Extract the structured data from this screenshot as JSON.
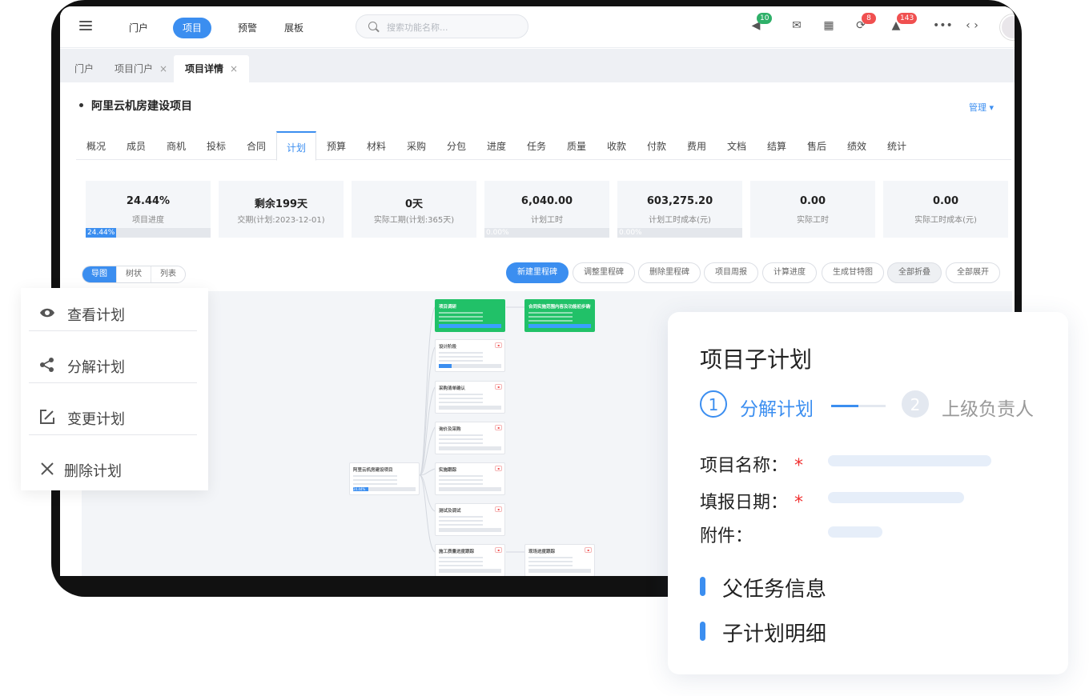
{
  "topnav": {
    "items": [
      "门户",
      "项目",
      "预警",
      "展板"
    ],
    "active_index": 1,
    "search_placeholder": "搜索功能名称...",
    "badges": {
      "announce": "10",
      "sync": "8",
      "bell": "143"
    },
    "icons": [
      "megaphone-icon",
      "mail-icon",
      "calendar-icon",
      "sync-icon",
      "bell-icon",
      "more-icon",
      "code-icon"
    ]
  },
  "page_tabs": [
    {
      "label": "门户",
      "closable": false
    },
    {
      "label": "项目门户",
      "closable": true
    },
    {
      "label": "项目详情",
      "closable": true,
      "active": true
    }
  ],
  "project": {
    "title": "阿里云机房建设项目",
    "manage_label": "管理",
    "subtabs": [
      "概况",
      "成员",
      "商机",
      "投标",
      "合同",
      "计划",
      "预算",
      "材料",
      "采购",
      "分包",
      "进度",
      "任务",
      "质量",
      "收款",
      "付款",
      "费用",
      "文档",
      "结算",
      "售后",
      "绩效",
      "统计"
    ],
    "active_subtab": "计划"
  },
  "stats": [
    {
      "value": "24.44%",
      "label": "项目进度",
      "bar_text": "24.44%",
      "progress": 24.44
    },
    {
      "value": "剩余199天",
      "label": "交期(计划:2023-12-01)"
    },
    {
      "value": "0天",
      "label": "实际工期(计划:365天)"
    },
    {
      "value": "6,040.00",
      "label": "计划工时",
      "bar_text": "0.00%",
      "progress": 0
    },
    {
      "value": "603,275.20",
      "label": "计划工时成本(元)",
      "bar_text": "0.00%",
      "progress": 0
    },
    {
      "value": "0.00",
      "label": "实际工时"
    },
    {
      "value": "0.00",
      "label": "实际工时成本(元)"
    }
  ],
  "view_switch": [
    "导图",
    "树状",
    "列表"
  ],
  "actions": [
    "新建里程碑",
    "调整里程碑",
    "删除里程碑",
    "项目周报",
    "计算进度",
    "生成甘特图",
    "全部折叠",
    "全部展开"
  ],
  "mindmap": {
    "root": {
      "title": "阿里云机房建设项目",
      "progress_text": "24.44%"
    },
    "nodes": [
      {
        "title": "项目调研",
        "green": true
      },
      {
        "title": "合同实施范围内容及功能初步确认",
        "green": true
      },
      {
        "title": "设计阶段",
        "green": false
      },
      {
        "title": "采购清单确认",
        "green": false
      },
      {
        "title": "询价及采购",
        "green": false
      },
      {
        "title": "实施跟踪",
        "green": false
      },
      {
        "title": "测试及调试",
        "green": false
      },
      {
        "title": "施工质量进度跟踪",
        "green": false
      },
      {
        "title": "现场进度跟踪",
        "green": false
      }
    ]
  },
  "context_menu": [
    {
      "label": "查看计划",
      "icon": "eye-icon"
    },
    {
      "label": "分解计划",
      "icon": "share-icon"
    },
    {
      "label": "变更计划",
      "icon": "edit-icon"
    },
    {
      "label": "删除计划",
      "icon": "close-icon"
    }
  ],
  "subplan_card": {
    "title": "项目子计划",
    "steps": [
      {
        "num": "1",
        "label": "分解计划"
      },
      {
        "num": "2",
        "label": "上级负责人"
      }
    ],
    "fields": [
      {
        "label": "项目名称：",
        "required": true
      },
      {
        "label": "填报日期：",
        "required": true
      },
      {
        "label": "附件：",
        "required": false
      }
    ],
    "required_mark": "*",
    "sections": [
      "父任务信息",
      "子计划明细"
    ]
  },
  "colors": {
    "accent": "#3b8ef0",
    "green": "#21c168",
    "danger": "#f05050"
  }
}
